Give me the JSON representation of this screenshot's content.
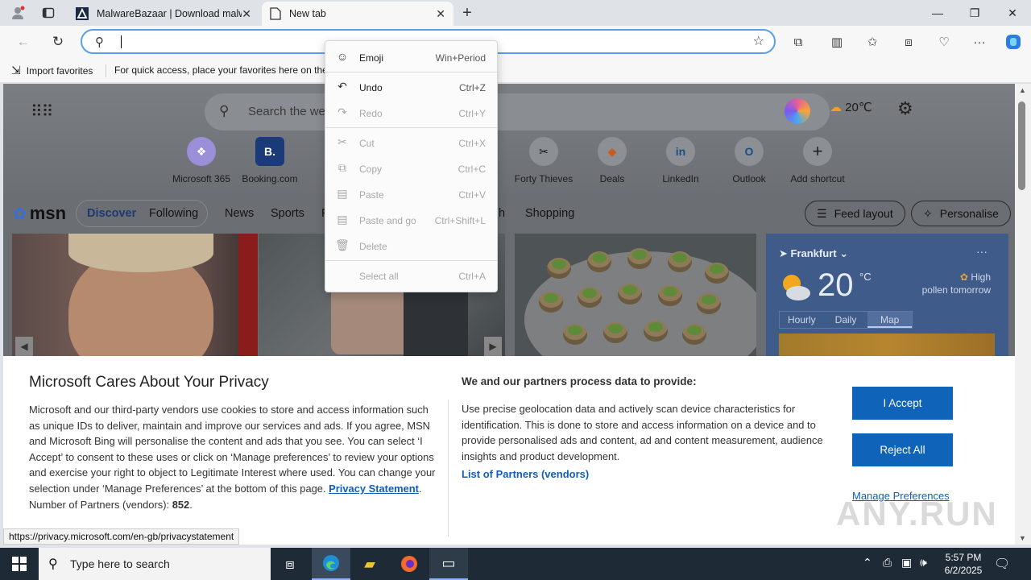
{
  "browser": {
    "tabs": [
      {
        "title": "MalwareBazaar | Download malware samples",
        "active": false
      },
      {
        "title": "New tab",
        "active": true
      }
    ],
    "address_value": "",
    "favorites_bar": {
      "import_label": "Import favorites",
      "hint": "For quick access, place your favorites here on the favorites bar."
    },
    "status_url": "https://privacy.microsoft.com/en-gb/privacystatement"
  },
  "context_menu": {
    "items": [
      {
        "label": "Emoji",
        "shortcut": "Win+Period",
        "enabled": true,
        "icon": "emoji-icon"
      },
      {
        "label": "Undo",
        "shortcut": "Ctrl+Z",
        "enabled": true,
        "icon": "undo-icon"
      },
      {
        "label": "Redo",
        "shortcut": "Ctrl+Y",
        "enabled": false,
        "icon": "redo-icon"
      },
      {
        "label": "Cut",
        "shortcut": "Ctrl+X",
        "enabled": false,
        "icon": "cut-icon"
      },
      {
        "label": "Copy",
        "shortcut": "Ctrl+C",
        "enabled": false,
        "icon": "copy-icon"
      },
      {
        "label": "Paste",
        "shortcut": "Ctrl+V",
        "enabled": false,
        "icon": "paste-icon"
      },
      {
        "label": "Paste and go",
        "shortcut": "Ctrl+Shift+L",
        "enabled": false,
        "icon": "paste-go-icon"
      },
      {
        "label": "Delete",
        "shortcut": "",
        "enabled": false,
        "icon": "delete-icon"
      },
      {
        "label": "Select all",
        "shortcut": "Ctrl+A",
        "enabled": false,
        "icon": ""
      }
    ]
  },
  "newtab": {
    "search_placeholder": "Search the web",
    "weather_mini": "20℃",
    "shortcuts": [
      {
        "label": "Microsoft 365",
        "glyph": "❖"
      },
      {
        "label": "Booking.com",
        "glyph": "B."
      },
      {
        "label": "Forty Thieves",
        "glyph": "✂"
      },
      {
        "label": "Deals",
        "glyph": "◆"
      },
      {
        "label": "LinkedIn",
        "glyph": "in"
      },
      {
        "label": "Outlook",
        "glyph": "O"
      },
      {
        "label": "Add shortcut",
        "glyph": "+"
      }
    ],
    "msn": {
      "logo": "msn",
      "nav": [
        "Discover",
        "Following",
        "News",
        "Sports",
        "P",
        "h",
        "Shopping"
      ],
      "feed_layout": "Feed layout",
      "personalise": "Personalise"
    },
    "weather_card": {
      "location": "Frankfurt",
      "temp": "20",
      "unit": "°C",
      "pollen_line1": "High",
      "pollen_line2": "pollen tomorrow",
      "tabs": [
        "Hourly",
        "Daily",
        "Map"
      ],
      "selected_tab": "Map"
    }
  },
  "privacy": {
    "title": "Microsoft Cares About Your Privacy",
    "body": "Microsoft and our third-party vendors use cookies to store and access information such as unique IDs to deliver, maintain and improve our services and ads. If you agree, MSN and Microsoft Bing will personalise the content and ads that you see. You can select ‘I Accept’ to consent to these uses or click on ‘Manage preferences’ to review your options and exercise your right to object to Legitimate Interest where used.  You can change your selection under ‘Manage Preferences’ at the bottom of this page.",
    "privacy_link": "Privacy Statement",
    "partners_count_label": "Number of Partners (vendors):",
    "partners_count": "852",
    "right_title": "We and our partners process data to provide:",
    "right_body": "Use precise geolocation data and actively scan device characteristics for identification. This is done to store and access information on a device and to provide personalised ads and content, ad and content measurement, audience insights and product development.",
    "partners_link": "List of Partners (vendors)",
    "accept": "I Accept",
    "reject": "Reject All",
    "manage": "Manage Preferences",
    "watermark": "ANY.RUN"
  },
  "taskbar": {
    "search_placeholder": "Type here to search",
    "time": "5:57 PM",
    "date": "6/2/2025"
  },
  "colors": {
    "accent": "#0f63b8",
    "link": "#0f5fb8",
    "taskbar": "#1e2a36"
  }
}
